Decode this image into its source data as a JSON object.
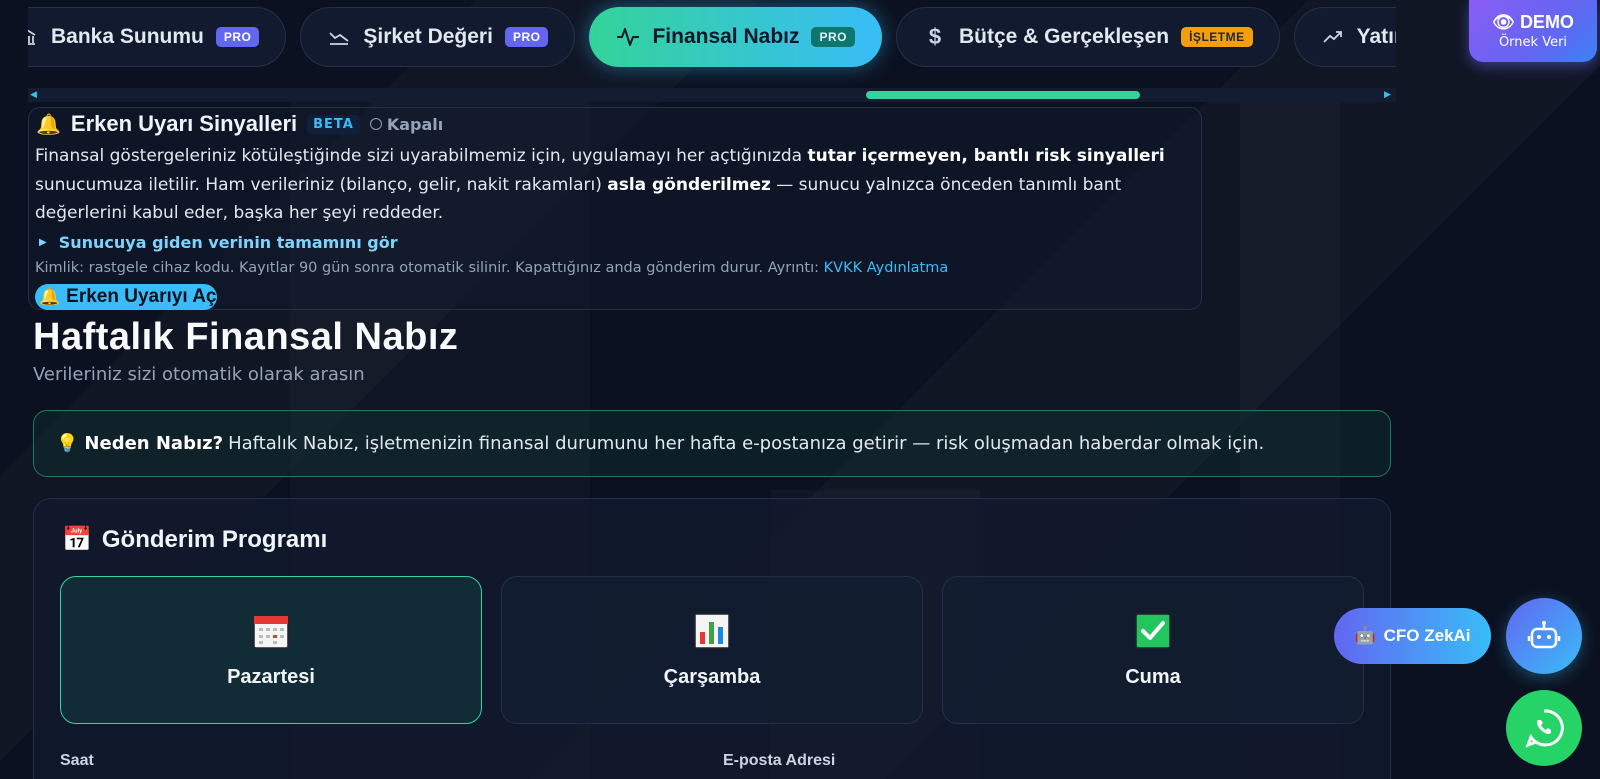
{
  "tabs": [
    {
      "label": "Banka Sunumu",
      "badge": "PRO",
      "icon": "bank-icon",
      "active": false
    },
    {
      "label": "Şirket Değeri",
      "badge": "PRO",
      "icon": "chart-line-icon",
      "active": false
    },
    {
      "label": "Finansal Nabız",
      "badge": "PRO",
      "icon": "pulse-icon",
      "active": true
    },
    {
      "label": "Bütçe & Gerçekleşen",
      "badge": "İŞLETME",
      "icon": "dollar-icon",
      "active": false
    },
    {
      "label": "Yatırım A",
      "badge": "",
      "icon": "trend-up-icon",
      "active": false
    }
  ],
  "demo": {
    "title": "DEMO",
    "subtitle": "Örnek Veri"
  },
  "early_warning": {
    "title": "Erken Uyarı Sinyalleri",
    "beta": "BETA",
    "status": "Kapalı",
    "text_parts": [
      "Finansal göstergeleriniz kötüleştiğinde sizi uyarabilmemiz için, uygulamayı her açtığınızda ",
      "tutar içermeyen, bantlı risk sinyalleri",
      " sunucumuza iletilir. Ham verileriniz (bilanço, gelir, nakit rakamları) ",
      "asla gönderilmez",
      " — sunucu yalnızca önceden tanımlı bant değerlerini kabul eder, başka her şeyi reddeder."
    ],
    "details_link": "Sunucuya giden verinin tamamını gör",
    "footnote": "Kimlik: rastgele cihaz kodu. Kayıtlar 90 gün sonra otomatik silinir. Kapattığınız anda gönderim durur. Ayrıntı: ",
    "footnote_link": "KVKK Aydınlatma",
    "enable_button": "Erken Uyarıyı Aç"
  },
  "page": {
    "title": "Haftalık Finansal Nabız",
    "subtitle": "Verileriniz sizi otomatik olarak arasın"
  },
  "why": {
    "label": "Neden Nabız?",
    "text": "Haftalık Nabız, işletmenizin finansal durumunu her hafta e-postanıza getirir — risk oluşmadan haberdar olmak için."
  },
  "schedule": {
    "title": "Gönderim Programı",
    "days": [
      {
        "label": "Pazartesi",
        "icon": "calendar-icon",
        "selected": true
      },
      {
        "label": "Çarşamba",
        "icon": "bar-chart-icon",
        "selected": false
      },
      {
        "label": "Cuma",
        "icon": "check-mark-icon",
        "selected": false
      }
    ],
    "time_label": "Saat",
    "email_label": "E-posta Adresi"
  },
  "floating": {
    "cfo_label": "CFO ZekAi"
  },
  "colors": {
    "accent_green": "#34d399",
    "accent_blue": "#38bdf8",
    "pro_badge": "#6366f1",
    "business_badge": "#f59e0b",
    "whatsapp": "#25d366"
  }
}
